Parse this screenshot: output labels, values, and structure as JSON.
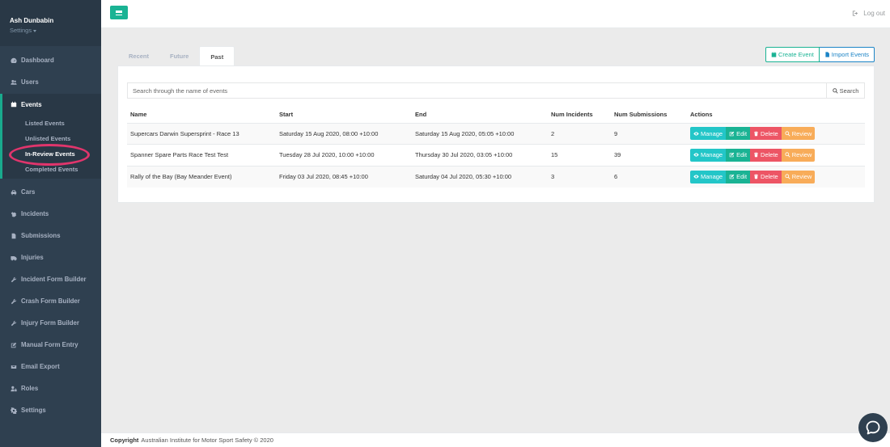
{
  "user": {
    "name": "Ash Dunbabin",
    "settings_label": "Settings"
  },
  "nav": {
    "dashboard": "Dashboard",
    "users": "Users",
    "events": "Events",
    "events_sub": [
      "Listed Events",
      "Unlisted Events",
      "In-Review Events",
      "Completed Events"
    ],
    "cars": "Cars",
    "incidents": "Incidents",
    "submissions": "Submissions",
    "injuries": "Injuries",
    "incident_form_builder": "Incident Form Builder",
    "crash_form_builder": "Crash Form Builder",
    "injury_form_builder": "Injury Form Builder",
    "manual_form_entry": "Manual Form Entry",
    "email_export": "Email Export",
    "roles": "Roles",
    "settings": "Settings"
  },
  "topbar": {
    "logout_label": "Log out"
  },
  "tabs": [
    "Recent",
    "Future",
    "Past"
  ],
  "buttons": {
    "create_event": "Create Event",
    "import_events": "Import Events"
  },
  "search": {
    "placeholder": "Search through the name of events",
    "button_label": "Search"
  },
  "table": {
    "headers": [
      "Name",
      "Start",
      "End",
      "Num Incidents",
      "Num Submissions",
      "Actions"
    ],
    "rows": [
      {
        "name": "Supercars Darwin Supersprint - Race 13",
        "start": "Saturday 15 Aug 2020, 08:00 +10:00",
        "end": "Saturday 15 Aug 2020, 05:05 +10:00",
        "incidents": "2",
        "submissions": "9"
      },
      {
        "name": "Spanner Spare Parts Race Test Test",
        "start": "Tuesday 28 Jul 2020, 10:00 +10:00",
        "end": "Thursday 30 Jul 2020, 03:05 +10:00",
        "incidents": "15",
        "submissions": "39"
      },
      {
        "name": "Rally of the Bay (Bay Meander Event)",
        "start": "Friday 03 Jul 2020, 08:45 +10:00",
        "end": "Saturday 04 Jul 2020, 05:30 +10:00",
        "incidents": "3",
        "submissions": "6"
      }
    ],
    "actions": {
      "manage": "Manage",
      "edit": "Edit",
      "delete": "Delete",
      "review": "Review"
    }
  },
  "footer": {
    "copyright_label": "Copyright",
    "copyright_text": "Australian Institute for Motor Sport Safety © 2020"
  },
  "colors": {
    "sidebar": "#2f4050",
    "primary": "#1ab394",
    "info": "#23c6c8",
    "danger": "#ed5565",
    "warning": "#f8ac59",
    "import": "#1c84c6",
    "highlight_ring": "#e0356c"
  }
}
